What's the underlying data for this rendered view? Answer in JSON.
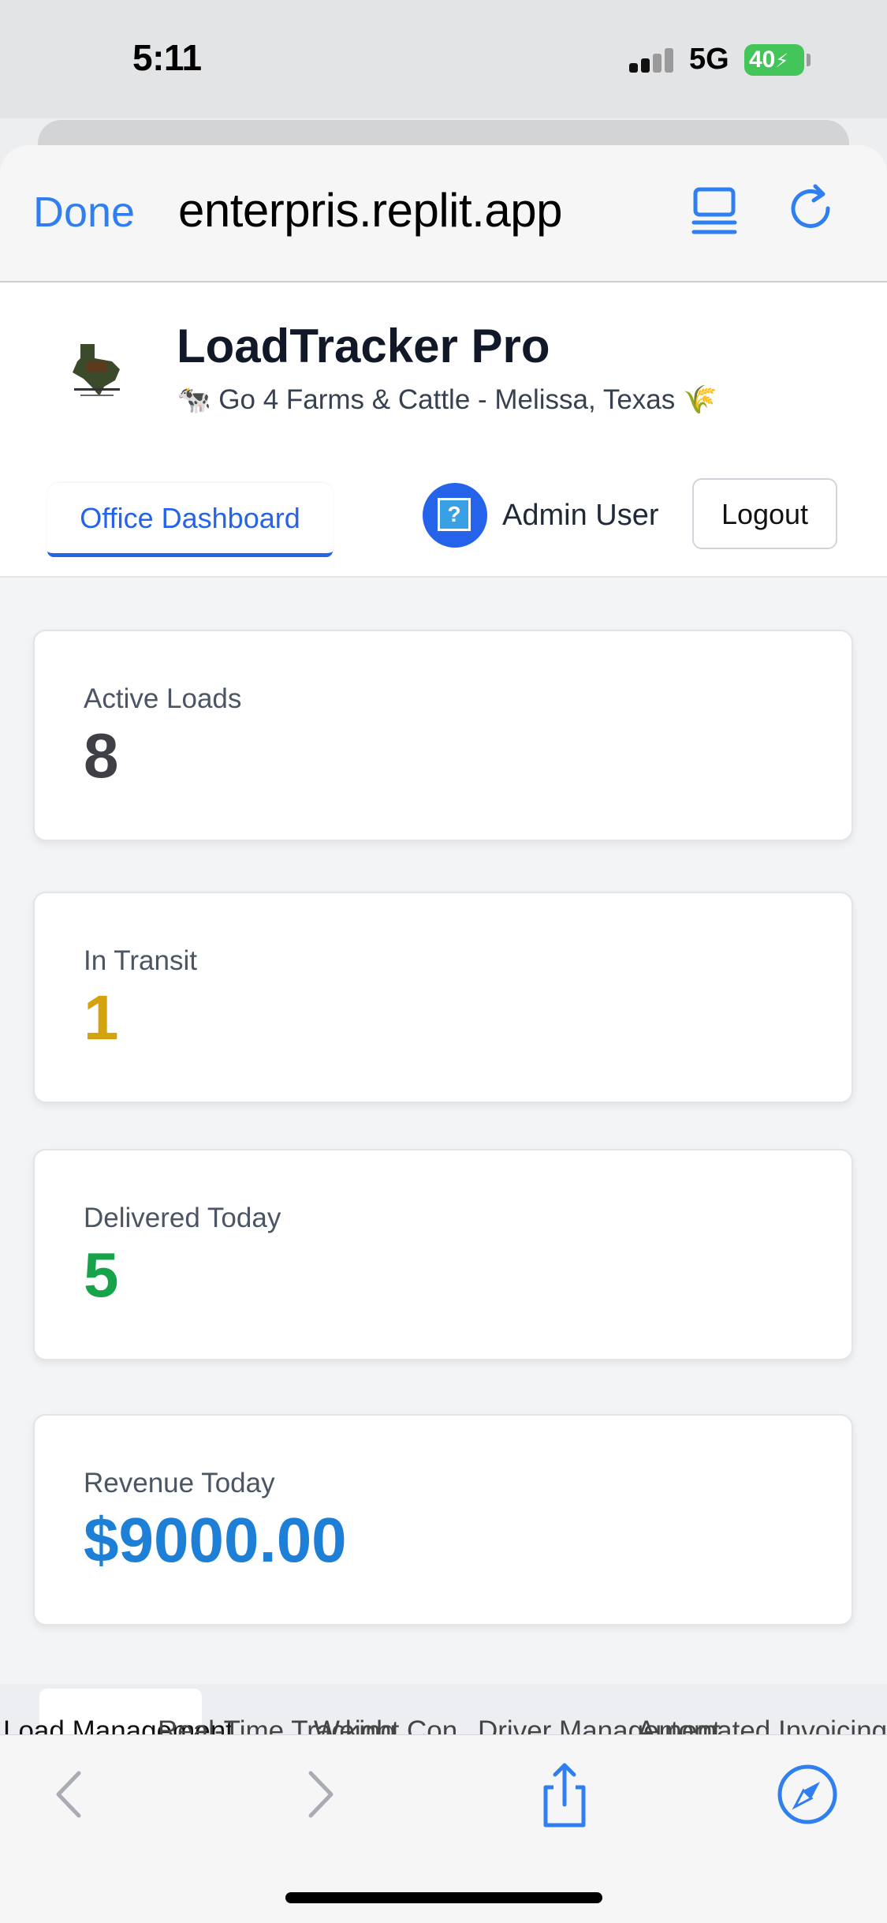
{
  "status_bar": {
    "time": "5:11",
    "network": "5G",
    "battery": "40"
  },
  "browser": {
    "done_label": "Done",
    "url": "enterpris.replit.app",
    "icons": [
      "reader-icon",
      "reload-icon",
      "back-icon",
      "forward-icon",
      "share-icon",
      "compass-icon"
    ]
  },
  "header": {
    "title": "LoadTracker Pro",
    "subtitle": "🐄 Go 4 Farms & Cattle - Melissa, Texas 🌾"
  },
  "nav": {
    "active_tab": "Office Dashboard",
    "avatar_glyph": "?",
    "user_name": "Admin User",
    "logout_label": "Logout"
  },
  "stats": [
    {
      "label": "Active Loads",
      "value": "8",
      "color": "#3f3f46"
    },
    {
      "label": "In Transit",
      "value": "1",
      "color": "#d4a20e"
    },
    {
      "label": "Delivered Today",
      "value": "5",
      "color": "#16a34a"
    },
    {
      "label": "Revenue Today",
      "value": "$9000.00",
      "color": "#1d7fd6"
    }
  ],
  "tabs_strip": {
    "items": [
      "Load Management",
      "Real-Time Tracking",
      "Weight Con...",
      "Driver Management",
      "Automated Invoicing"
    ]
  },
  "colors": {
    "accent": "#2563eb",
    "safari_blue": "#2f7ff0"
  }
}
